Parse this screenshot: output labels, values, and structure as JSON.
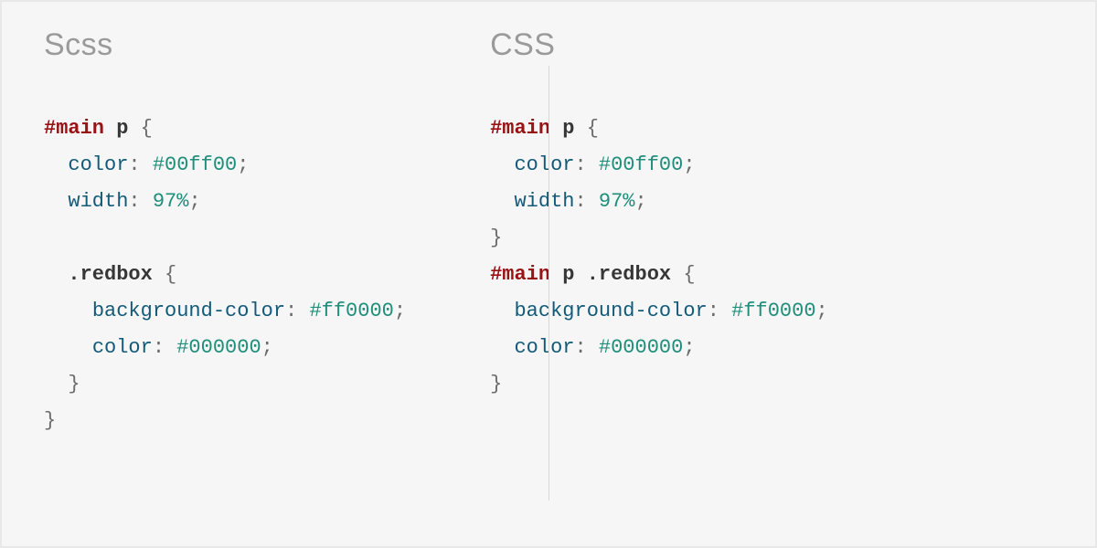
{
  "left": {
    "title": "Scss",
    "code": [
      [
        {
          "t": "#main",
          "cls": "c-sel"
        },
        {
          "t": " ",
          "cls": ""
        },
        {
          "t": "p",
          "cls": "c-sel2"
        },
        {
          "t": " {",
          "cls": "c-brace"
        }
      ],
      [
        {
          "t": "  ",
          "cls": ""
        },
        {
          "t": "color",
          "cls": "c-prop"
        },
        {
          "t": ": ",
          "cls": "c-punc"
        },
        {
          "t": "#00ff00",
          "cls": "c-val"
        },
        {
          "t": ";",
          "cls": "c-punc"
        }
      ],
      [
        {
          "t": "  ",
          "cls": ""
        },
        {
          "t": "width",
          "cls": "c-prop"
        },
        {
          "t": ": ",
          "cls": "c-punc"
        },
        {
          "t": "97%",
          "cls": "c-val"
        },
        {
          "t": ";",
          "cls": "c-punc"
        }
      ],
      [
        {
          "t": " ",
          "cls": ""
        }
      ],
      [
        {
          "t": "  ",
          "cls": ""
        },
        {
          "t": ".redbox",
          "cls": "c-sel2"
        },
        {
          "t": " {",
          "cls": "c-brace"
        }
      ],
      [
        {
          "t": "    ",
          "cls": ""
        },
        {
          "t": "background-color",
          "cls": "c-prop"
        },
        {
          "t": ": ",
          "cls": "c-punc"
        },
        {
          "t": "#ff0000",
          "cls": "c-val"
        },
        {
          "t": ";",
          "cls": "c-punc"
        }
      ],
      [
        {
          "t": "    ",
          "cls": ""
        },
        {
          "t": "color",
          "cls": "c-prop"
        },
        {
          "t": ": ",
          "cls": "c-punc"
        },
        {
          "t": "#000000",
          "cls": "c-val"
        },
        {
          "t": ";",
          "cls": "c-punc"
        }
      ],
      [
        {
          "t": "  }",
          "cls": "c-brace"
        }
      ],
      [
        {
          "t": "}",
          "cls": "c-brace"
        }
      ]
    ]
  },
  "right": {
    "title": "CSS",
    "code": [
      [
        {
          "t": "#main",
          "cls": "c-sel"
        },
        {
          "t": " ",
          "cls": ""
        },
        {
          "t": "p",
          "cls": "c-sel2"
        },
        {
          "t": " {",
          "cls": "c-brace"
        }
      ],
      [
        {
          "t": "  ",
          "cls": ""
        },
        {
          "t": "color",
          "cls": "c-prop"
        },
        {
          "t": ": ",
          "cls": "c-punc"
        },
        {
          "t": "#00ff00",
          "cls": "c-val"
        },
        {
          "t": ";",
          "cls": "c-punc"
        }
      ],
      [
        {
          "t": "  ",
          "cls": ""
        },
        {
          "t": "width",
          "cls": "c-prop"
        },
        {
          "t": ": ",
          "cls": "c-punc"
        },
        {
          "t": "97%",
          "cls": "c-val"
        },
        {
          "t": ";",
          "cls": "c-punc"
        }
      ],
      [
        {
          "t": "}",
          "cls": "c-brace"
        }
      ],
      [
        {
          "t": "#main",
          "cls": "c-sel"
        },
        {
          "t": " ",
          "cls": ""
        },
        {
          "t": "p",
          "cls": "c-sel2"
        },
        {
          "t": " ",
          "cls": ""
        },
        {
          "t": ".redbox",
          "cls": "c-sel2"
        },
        {
          "t": " {",
          "cls": "c-brace"
        }
      ],
      [
        {
          "t": "  ",
          "cls": ""
        },
        {
          "t": "background-color",
          "cls": "c-prop"
        },
        {
          "t": ": ",
          "cls": "c-punc"
        },
        {
          "t": "#ff0000",
          "cls": "c-val"
        },
        {
          "t": ";",
          "cls": "c-punc"
        }
      ],
      [
        {
          "t": "  ",
          "cls": ""
        },
        {
          "t": "color",
          "cls": "c-prop"
        },
        {
          "t": ": ",
          "cls": "c-punc"
        },
        {
          "t": "#000000",
          "cls": "c-val"
        },
        {
          "t": ";",
          "cls": "c-punc"
        }
      ],
      [
        {
          "t": "}",
          "cls": "c-brace"
        }
      ]
    ]
  }
}
